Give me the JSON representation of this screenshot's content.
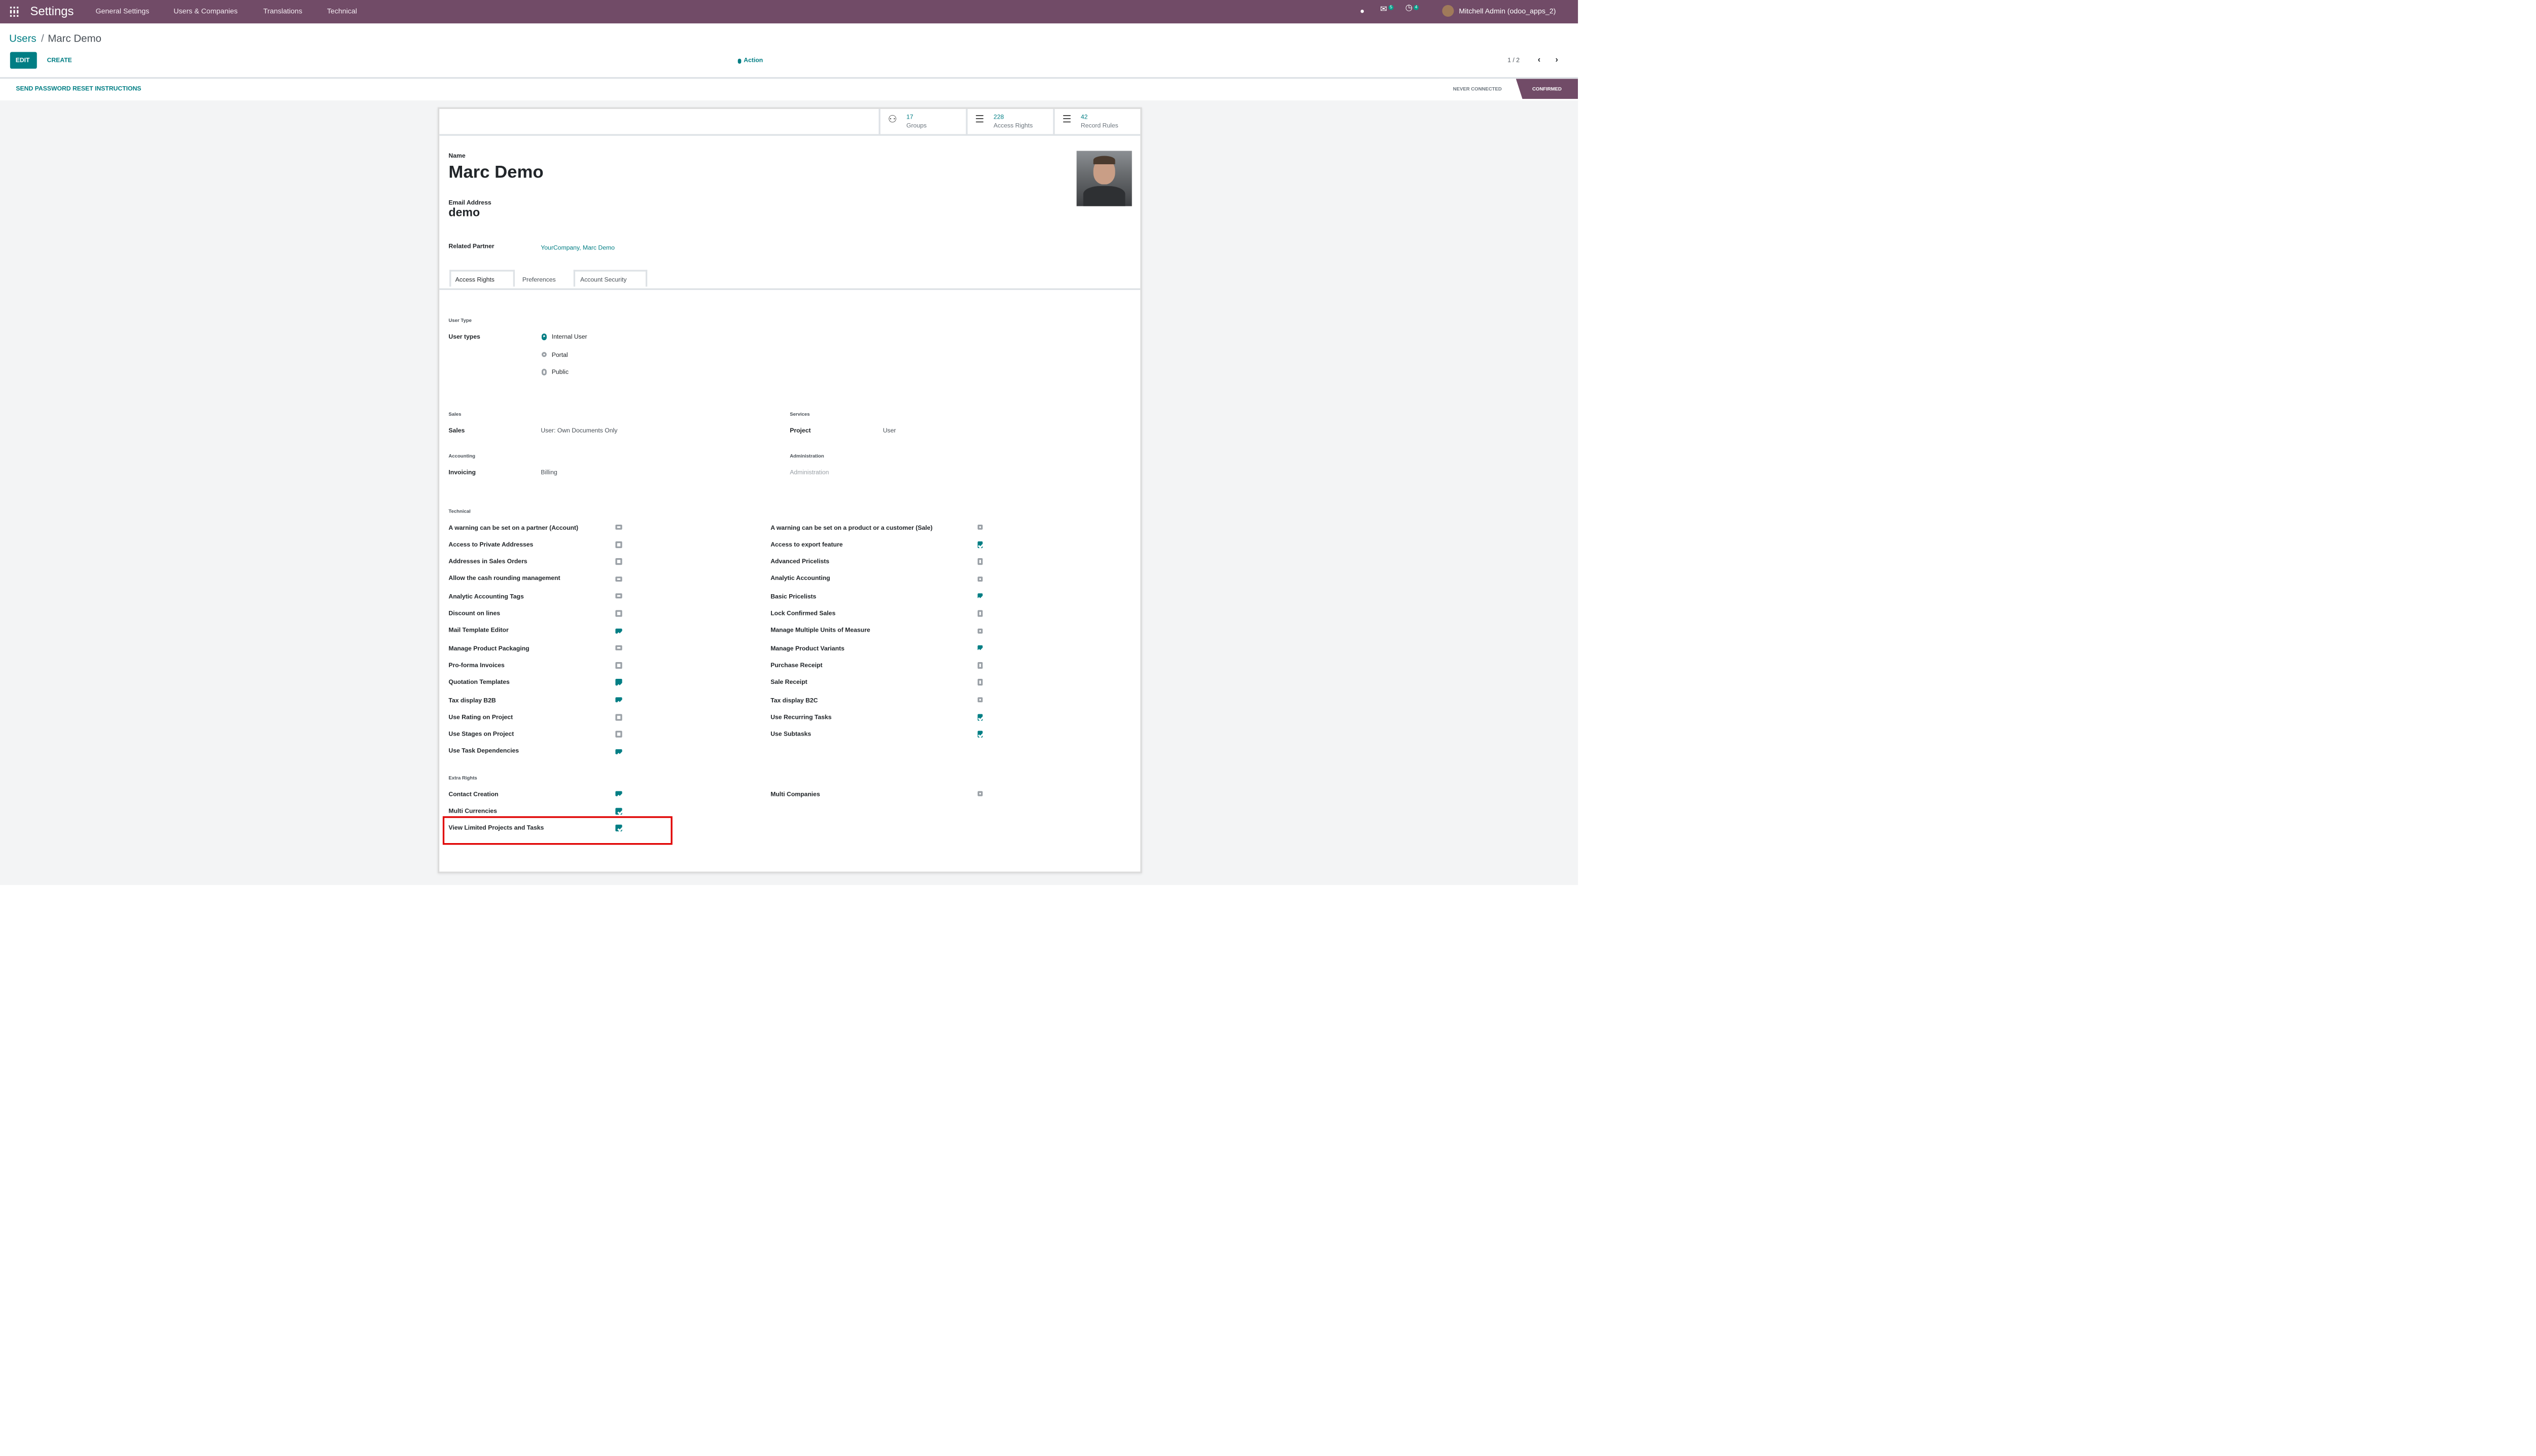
{
  "navbar": {
    "app_title": "Settings",
    "menu": [
      "General Settings",
      "Users & Companies",
      "Translations",
      "Technical"
    ],
    "messages_count": "5",
    "activities_count": "4",
    "user": "Mitchell Admin (odoo_apps_2)"
  },
  "breadcrumb": {
    "parent": "Users",
    "separator": "/",
    "current": "Marc Demo"
  },
  "toolbar": {
    "edit": "EDIT",
    "create": "CREATE",
    "action": "Action",
    "pager": "1 / 2"
  },
  "statusbar": {
    "send_reset": "SEND PASSWORD RESET INSTRUCTIONS",
    "stages": [
      "NEVER CONNECTED",
      "CONFIRMED"
    ],
    "active_stage": "CONFIRMED"
  },
  "smart_buttons": [
    {
      "count": "17",
      "label": "Groups",
      "icon": "users-icon"
    },
    {
      "count": "228",
      "label": "Access Rights",
      "icon": "list-icon"
    },
    {
      "count": "42",
      "label": "Record Rules",
      "icon": "list-icon"
    }
  ],
  "form": {
    "name_label": "Name",
    "name": "Marc Demo",
    "email_label": "Email Address",
    "email": "demo",
    "partner_label": "Related Partner",
    "partner": "YourCompany, Marc Demo"
  },
  "tabs": [
    "Access Rights",
    "Preferences",
    "Account Security"
  ],
  "active_tab": "Access Rights",
  "user_type": {
    "heading": "User Type",
    "label": "User types",
    "options": [
      "Internal User",
      "Portal",
      "Public"
    ],
    "selected": "Internal User"
  },
  "apps": {
    "sales_heading": "Sales",
    "sales_label": "Sales",
    "sales_value": "User: Own Documents Only",
    "services_heading": "Services",
    "project_label": "Project",
    "project_value": "User",
    "accounting_heading": "Accounting",
    "invoicing_label": "Invoicing",
    "invoicing_value": "Billing",
    "administration_heading": "Administration",
    "administration_value": "Administration"
  },
  "technical": {
    "heading": "Technical",
    "left": [
      {
        "label": "A warning can be set on a partner (Account)",
        "checked": false
      },
      {
        "label": "Access to Private Addresses",
        "checked": false
      },
      {
        "label": "Addresses in Sales Orders",
        "checked": false
      },
      {
        "label": "Allow the cash rounding management",
        "checked": false
      },
      {
        "label": "Analytic Accounting Tags",
        "checked": false
      },
      {
        "label": "Discount on lines",
        "checked": false
      },
      {
        "label": "Mail Template Editor",
        "checked": true
      },
      {
        "label": "Manage Product Packaging",
        "checked": false
      },
      {
        "label": "Pro-forma Invoices",
        "checked": false
      },
      {
        "label": "Quotation Templates",
        "checked": true
      },
      {
        "label": "Tax display B2B",
        "checked": true
      },
      {
        "label": "Use Rating on Project",
        "checked": false
      },
      {
        "label": "Use Stages on Project",
        "checked": false
      },
      {
        "label": "Use Task Dependencies",
        "checked": true
      }
    ],
    "right": [
      {
        "label": "A warning can be set on a product or a customer (Sale)",
        "checked": false
      },
      {
        "label": "Access to export feature",
        "checked": true
      },
      {
        "label": "Advanced Pricelists",
        "checked": false
      },
      {
        "label": "Analytic Accounting",
        "checked": false
      },
      {
        "label": "Basic Pricelists",
        "checked": true
      },
      {
        "label": "Lock Confirmed Sales",
        "checked": false
      },
      {
        "label": "Manage Multiple Units of Measure",
        "checked": false
      },
      {
        "label": "Manage Product Variants",
        "checked": true
      },
      {
        "label": "Purchase Receipt",
        "checked": false
      },
      {
        "label": "Sale Receipt",
        "checked": false
      },
      {
        "label": "Tax display B2C",
        "checked": false
      },
      {
        "label": "Use Recurring Tasks",
        "checked": true
      },
      {
        "label": "Use Subtasks",
        "checked": true
      }
    ]
  },
  "extra_rights": {
    "heading": "Extra Rights",
    "left": [
      {
        "label": "Contact Creation",
        "checked": true
      },
      {
        "label": "Multi Currencies",
        "checked": true
      },
      {
        "label": "View Limited Projects and Tasks",
        "checked": true
      }
    ],
    "right": [
      {
        "label": "Multi Companies",
        "checked": false
      }
    ]
  },
  "colors": {
    "brand": "#714B67",
    "accent": "#017e84",
    "highlight": "#e00000"
  }
}
